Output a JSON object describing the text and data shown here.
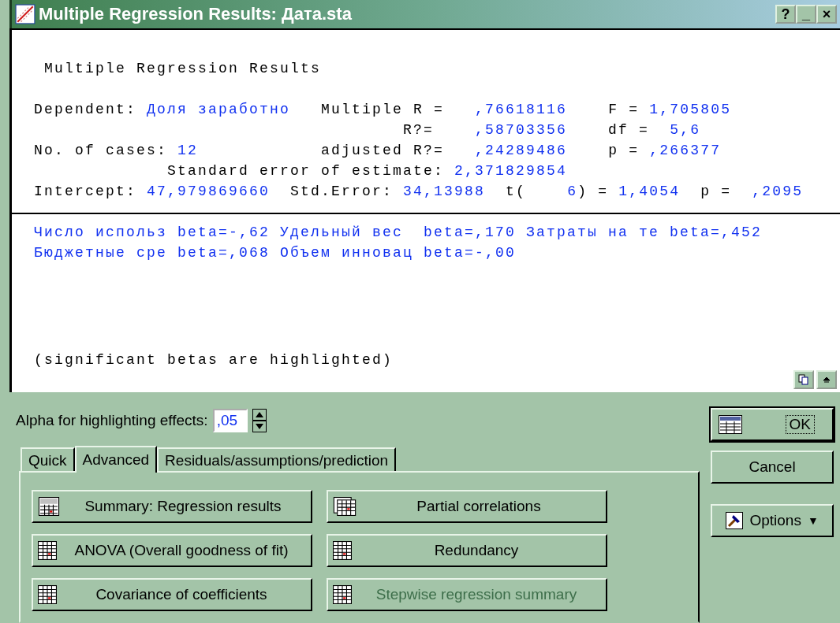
{
  "window": {
    "title": "Multiple Regression Results: Дата.sta",
    "controls": [
      "?",
      "_",
      "×"
    ]
  },
  "report": {
    "lines": [
      [
        {
          "kind": "label",
          "text": " Multiple Regression Results"
        }
      ],
      [
        {
          "kind": "label",
          "text": "Dependent: "
        },
        {
          "kind": "value",
          "text": "Доля заработно"
        },
        {
          "kind": "label",
          "text": "   Multiple R =   "
        },
        {
          "kind": "value",
          "text": ",76618116"
        },
        {
          "kind": "label",
          "text": "    F = "
        },
        {
          "kind": "value",
          "text": "1,705805"
        }
      ],
      [
        {
          "kind": "label",
          "text": "                                    R?=    "
        },
        {
          "kind": "value",
          "text": ",58703356"
        },
        {
          "kind": "label",
          "text": "    df =  "
        },
        {
          "kind": "value",
          "text": "5,6"
        }
      ],
      [
        {
          "kind": "label",
          "text": "No. of cases: "
        },
        {
          "kind": "value",
          "text": "12"
        },
        {
          "kind": "label",
          "text": "            adjusted R?=   "
        },
        {
          "kind": "value",
          "text": ",24289486"
        },
        {
          "kind": "label",
          "text": "    p = "
        },
        {
          "kind": "value",
          "text": ",266377"
        }
      ],
      [
        {
          "kind": "label",
          "text": "             Standard error of estimate: "
        },
        {
          "kind": "value",
          "text": "2,371829854"
        }
      ],
      [
        {
          "kind": "label",
          "text": "Intercept: "
        },
        {
          "kind": "value",
          "text": "47,979869660"
        },
        {
          "kind": "label",
          "text": "  Std.Error: "
        },
        {
          "kind": "value",
          "text": "34,13988"
        },
        {
          "kind": "label",
          "text": "  t(    "
        },
        {
          "kind": "value",
          "text": "6"
        },
        {
          "kind": "label",
          "text": ") = "
        },
        {
          "kind": "value",
          "text": "1,4054"
        },
        {
          "kind": "label",
          "text": "  p =  "
        },
        {
          "kind": "value",
          "text": ",2095"
        }
      ]
    ],
    "betas": [
      [
        {
          "kind": "value",
          "text": "Число использ beta=-,62 Удельный вес  beta=,170 Затраты на те beta=,452"
        }
      ],
      [
        {
          "kind": "value",
          "text": "Бюджетные сре beta=,068 Объем инновац beta=-,00"
        }
      ]
    ],
    "note": "(significant betas are highlighted)"
  },
  "alpha": {
    "label": "Alpha for highlighting effects:",
    "value": ",05"
  },
  "tabs": [
    {
      "label": "Quick",
      "selected": false
    },
    {
      "label": "Advanced",
      "selected": true
    },
    {
      "label": "Residuals/assumptions/prediction",
      "selected": false
    }
  ],
  "actions": [
    {
      "label": "Summary:  Regression results",
      "disabled": false
    },
    {
      "label": "Partial correlations",
      "disabled": false
    },
    {
      "label": "ANOVA (Overall goodness of fit)",
      "disabled": false
    },
    {
      "label": "Redundancy",
      "disabled": false
    },
    {
      "label": "Covariance of coefficients",
      "disabled": false
    },
    {
      "label": "Stepwise regression summary",
      "disabled": true
    }
  ],
  "side_buttons": [
    {
      "label": "OK",
      "kind": "ok"
    },
    {
      "label": "Cancel",
      "kind": "plain"
    },
    {
      "label": "Options",
      "kind": "menu",
      "caret": "▼"
    }
  ]
}
